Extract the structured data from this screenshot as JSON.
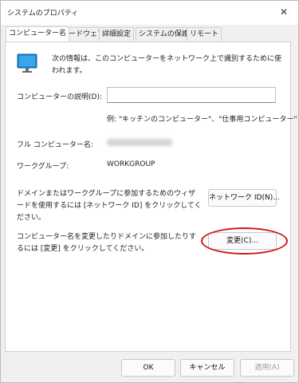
{
  "window": {
    "title": "システムのプロパティ",
    "close_glyph": "✕"
  },
  "tabs": [
    {
      "label": "コンピューター名"
    },
    {
      "label": "ハードウェア"
    },
    {
      "label": "詳細設定"
    },
    {
      "label": "システムの保護"
    },
    {
      "label": "リモート"
    }
  ],
  "panel": {
    "icon": "computer-monitor-icon",
    "info_text": "次の情報は、このコンピューターをネットワーク上で識別するために使われます。",
    "description_label": "コンピューターの説明(D):",
    "description_value": "",
    "example_text": "例: \"キッチンのコンピューター\"、\"仕事用コンピューター\"",
    "fullname_label": "フル コンピューター名:",
    "workgroup_label": "ワークグループ:",
    "workgroup_value": "WORKGROUP",
    "network_text": "ドメインまたはワークグループに参加するためのウィザードを使用するには [ネットワーク ID] をクリックしてください。",
    "network_button": "ネットワーク ID(N)...",
    "change_text": "コンピューター名を変更したりドメインに参加したりするには [変更] をクリックしてください。",
    "change_button": "変更(C)..."
  },
  "footer": {
    "ok": "OK",
    "cancel": "キャンセル",
    "apply": "適用(A)"
  },
  "colors": {
    "highlight_ellipse": "#d01919",
    "icon_blue": "#1c8ad6"
  }
}
